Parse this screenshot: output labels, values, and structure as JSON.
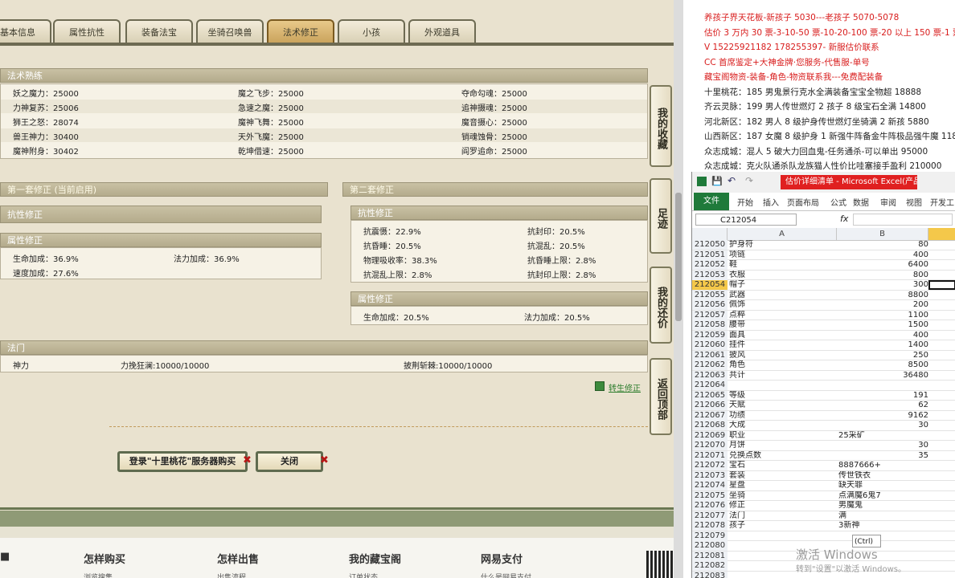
{
  "tabs": [
    {
      "label": "基本信息",
      "active": false
    },
    {
      "label": "属性抗性",
      "active": false
    },
    {
      "label": "装备法宝",
      "active": false
    },
    {
      "label": "坐骑召唤兽",
      "active": false
    },
    {
      "label": "法术修正",
      "active": true
    },
    {
      "label": "小孩",
      "active": false
    },
    {
      "label": "外观道具",
      "active": false
    }
  ],
  "spell_mastery": {
    "title": "法术熟练",
    "rows": [
      [
        "妖之魔力：25000",
        "魔之飞步：25000",
        "夺命勾魂：25000"
      ],
      [
        "力神复苏：25006",
        "急速之魔：25000",
        "追神摄魂：25000"
      ],
      [
        "狮王之怒：28074",
        "魔神飞舞：25000",
        "魔音摄心：25000"
      ],
      [
        "兽王神力：30400",
        "天外飞魔：25000",
        "销魂蚀骨：25000"
      ],
      [
        "魔神附身：30402",
        "乾坤借速：25000",
        "阎罗追命：25000"
      ]
    ]
  },
  "set1": {
    "title": "第一套修正 (当前启用)",
    "resist_title": "抗性修正",
    "attr_title": "属性修正",
    "attr_rows": [
      [
        "生命加成：36.9%",
        "法力加成：36.9%"
      ],
      [
        "速度加成：27.6%",
        ""
      ]
    ]
  },
  "set2": {
    "title": "第二套修正",
    "resist_title": "抗性修正",
    "resist_rows": [
      [
        "抗震慑：22.9%",
        "抗封印：20.5%"
      ],
      [
        "抗昏睡：20.5%",
        "抗混乱：20.5%"
      ],
      [
        "物理吸收率：38.3%",
        "抗昏睡上限：2.8%"
      ],
      [
        "抗混乱上限：2.8%",
        "抗封印上限：2.8%"
      ]
    ],
    "attr_title": "属性修正",
    "attr_rows": [
      [
        "生命加成：20.5%",
        "法力加成：20.5%"
      ]
    ]
  },
  "faction": {
    "title": "法门",
    "cells": [
      "神力",
      "力挽狂澜:10000/10000",
      "披荆斩棘:10000/10000"
    ]
  },
  "rebirth_link": "转生修正",
  "side_buttons": [
    "我的收藏",
    "足迹",
    "我的还价",
    "返回顶部"
  ],
  "login_button": "登录\"十里桃花\"服务器购买",
  "close_button": "关闭",
  "footer_titles": [
    "怎样购买",
    "怎样出售",
    "我的藏宝阁",
    "网易支付"
  ],
  "footer_subs": [
    "浏览搜集",
    "出售流程",
    "订单状态",
    "什么是网易支付"
  ],
  "doc": {
    "lines": [
      {
        "text": "养孩子界天花板-新孩子 5030---老孩子 5070-5078",
        "color": "#d81b1b"
      },
      {
        "text": "估价 3 万内 30 票-3-10-50 票-10-20-100 票-20 以上 150 票-1 票",
        "color": "#d81b1b"
      },
      {
        "text": "V 15225921182  178255397- 新服估价联系",
        "color": "#d81b1b"
      },
      {
        "text": "CC 首席鉴定+大神金牌·您服务-代售服-单号",
        "color": "#d81b1b"
      },
      {
        "text": "藏宝阁物资-装备-角色-物资联系我---免费配装备",
        "color": "#d81b1b"
      },
      {
        "text": "十里桃花：185 男鬼景行克水全满装备宝宝全物超 18888",
        "color": "#222222"
      },
      {
        "text": "齐云灵脉：199 男人传世燃灯 2 孩子 8 级宝石全满 14800",
        "color": "#222222"
      },
      {
        "text": "河北新区：182 男人 8 级护身传世燃灯坐骑满 2 新孩 5880",
        "color": "#222222"
      },
      {
        "text": "山西新区：187 女魔 8 级护身 1 新强牛阵备金牛阵极品强牛魔 118",
        "color": "#222222"
      },
      {
        "text": "众志成城：混人 5 破大力回血鬼-任务通杀-可以单出 95000",
        "color": "#222222"
      },
      {
        "text": "众志成城：克火队通杀队龙族猫人性价比哇塞接手盈利 210000",
        "color": "#222222"
      }
    ]
  },
  "excel": {
    "title": "估价详细清单 - Microsoft Excel(产品...",
    "file_tab": "文件",
    "ribbon_tabs": [
      "开始",
      "插入",
      "页面布局",
      "公式",
      "数据",
      "审阅",
      "视图",
      "开发工"
    ],
    "name_box": "C212054",
    "fx": "fx",
    "columns": [
      "A",
      "B"
    ],
    "rows": [
      {
        "n": "212050",
        "a": "护身符",
        "b": "80",
        "num": true
      },
      {
        "n": "212051",
        "a": "项链",
        "b": "400",
        "num": true
      },
      {
        "n": "212052",
        "a": "鞋",
        "b": "6400",
        "num": true
      },
      {
        "n": "212053",
        "a": "衣服",
        "b": "800",
        "num": true
      },
      {
        "n": "212054",
        "a": "帽子",
        "b": "300",
        "num": true,
        "sel": true
      },
      {
        "n": "212055",
        "a": "武器",
        "b": "8800",
        "num": true
      },
      {
        "n": "212056",
        "a": "佩饰",
        "b": "200",
        "num": true
      },
      {
        "n": "212057",
        "a": "点粹",
        "b": "1100",
        "num": true
      },
      {
        "n": "212058",
        "a": "腰带",
        "b": "1500",
        "num": true
      },
      {
        "n": "212059",
        "a": "面具",
        "b": "400",
        "num": true
      },
      {
        "n": "212060",
        "a": "挂件",
        "b": "1400",
        "num": true
      },
      {
        "n": "212061",
        "a": "披风",
        "b": "250",
        "num": true
      },
      {
        "n": "212062",
        "a": "角色",
        "b": "8500",
        "num": true
      },
      {
        "n": "212063",
        "a": "共计",
        "b": "36480",
        "num": true
      },
      {
        "n": "212064",
        "a": "",
        "b": "",
        "num": true
      },
      {
        "n": "212065",
        "a": "等级",
        "b": "191",
        "num": true
      },
      {
        "n": "212066",
        "a": "天赋",
        "b": "62",
        "num": true
      },
      {
        "n": "212067",
        "a": "功绩",
        "b": "9162",
        "num": true
      },
      {
        "n": "212068",
        "a": "大成",
        "b": "30",
        "num": true
      },
      {
        "n": "212069",
        "a": "职业",
        "b": "25采矿",
        "num": false
      },
      {
        "n": "212070",
        "a": "月饼",
        "b": "30",
        "num": true
      },
      {
        "n": "212071",
        "a": "兑换点数",
        "b": "35",
        "num": true
      },
      {
        "n": "212072",
        "a": "宝石",
        "b": "8887666+",
        "num": false
      },
      {
        "n": "212073",
        "a": "套装",
        "b": "传世铁衣",
        "num": false
      },
      {
        "n": "212074",
        "a": "星盘",
        "b": "缺天罪",
        "num": false
      },
      {
        "n": "212075",
        "a": "坐骑",
        "b": "点满魔6鬼7",
        "num": false
      },
      {
        "n": "212076",
        "a": "修正",
        "b": "男魔鬼",
        "num": false
      },
      {
        "n": "212077",
        "a": "法门",
        "b": "满",
        "num": false
      },
      {
        "n": "212078",
        "a": "孩子",
        "b": "3新神",
        "num": false
      },
      {
        "n": "212079",
        "a": "",
        "b": "",
        "num": false
      },
      {
        "n": "212080",
        "a": "",
        "b": "",
        "num": false
      },
      {
        "n": "212081",
        "a": "",
        "b": "",
        "num": false
      },
      {
        "n": "212082",
        "a": "",
        "b": "",
        "num": false
      },
      {
        "n": "212083",
        "a": "",
        "b": "",
        "num": false
      }
    ],
    "paste_tag": "(Ctrl)"
  },
  "watermark": {
    "line1": "激活 Windows",
    "line2": "转到\"设置\"以激活 Windows。"
  }
}
